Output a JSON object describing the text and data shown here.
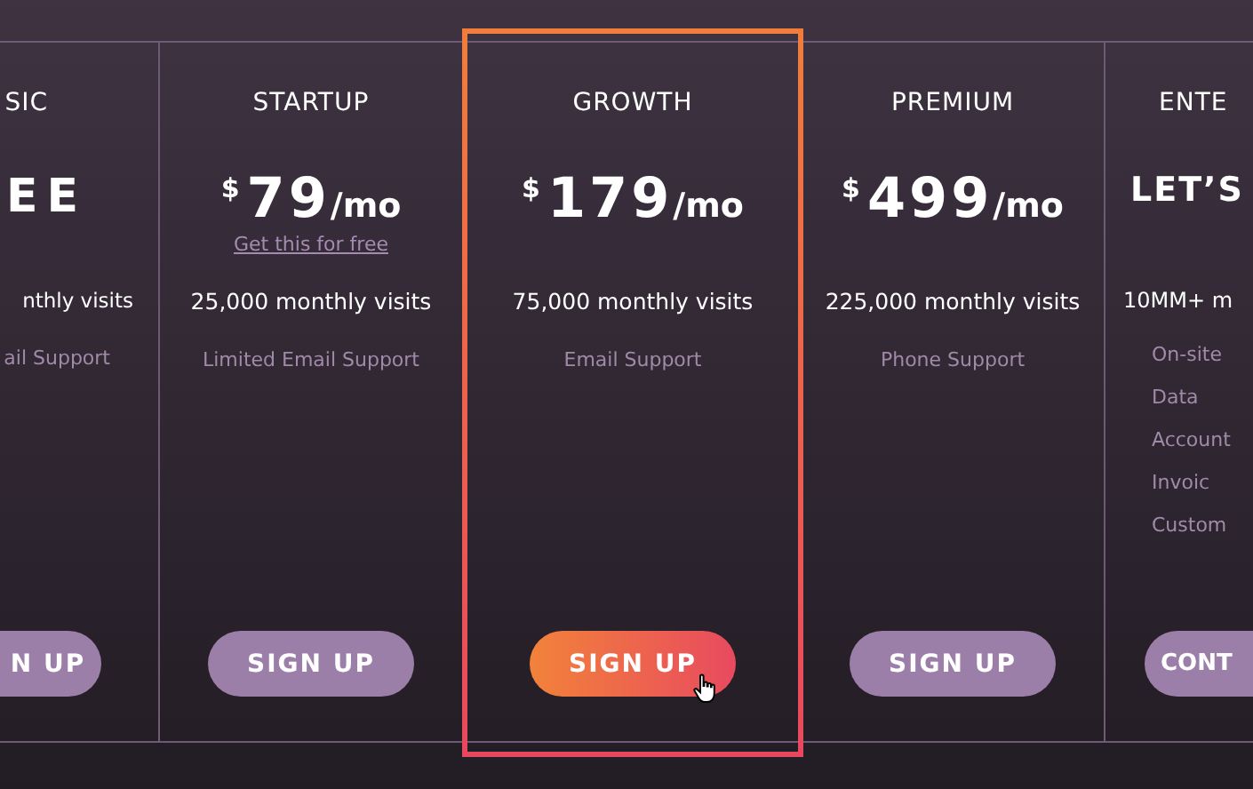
{
  "plans": [
    {
      "name": "SIC",
      "price": {
        "kind": "text",
        "text": "EE"
      },
      "visits": "nthly visits",
      "features": [
        "ail Support"
      ],
      "button": "N UP",
      "highlighted": false
    },
    {
      "name": "STARTUP",
      "price": {
        "kind": "amount",
        "currency": "$",
        "amount": "79",
        "period": "/mo"
      },
      "link": "Get this for free",
      "visits": "25,000 monthly visits",
      "features": [
        "Limited Email Support"
      ],
      "button": "SIGN UP",
      "highlighted": false
    },
    {
      "name": "GROWTH",
      "price": {
        "kind": "amount",
        "currency": "$",
        "amount": "179",
        "period": "/mo"
      },
      "visits": "75,000 monthly visits",
      "features": [
        "Email Support"
      ],
      "button": "SIGN UP",
      "highlighted": true
    },
    {
      "name": "PREMIUM",
      "price": {
        "kind": "amount",
        "currency": "$",
        "amount": "499",
        "period": "/mo"
      },
      "visits": "225,000 monthly visits",
      "features": [
        "Phone Support"
      ],
      "button": "SIGN UP",
      "highlighted": false
    },
    {
      "name": "ENTE",
      "price": {
        "kind": "text",
        "text": "LET’S"
      },
      "visits": "10MM+ m",
      "features": [
        "On-site",
        "Data",
        "Account",
        "Invoic",
        "Custom"
      ],
      "button": "CONT",
      "highlighted": false
    }
  ]
}
